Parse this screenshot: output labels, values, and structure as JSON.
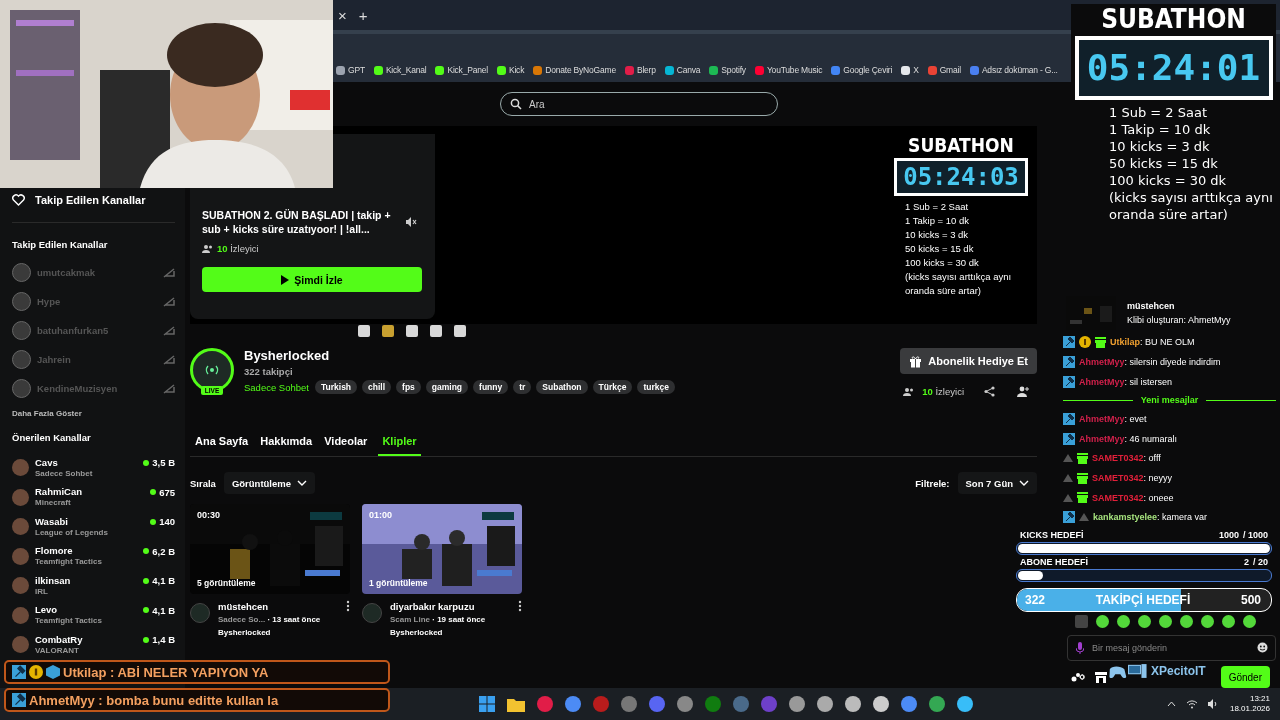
{
  "browser": {
    "tab_close": "×",
    "new_tab": "+",
    "bookmarks": [
      {
        "label": "GPT",
        "color": "#9ca3af"
      },
      {
        "label": "Kick_Kanal",
        "color": "#53fc18"
      },
      {
        "label": "Kick_Panel",
        "color": "#53fc18"
      },
      {
        "label": "Kick",
        "color": "#53fc18"
      },
      {
        "label": "Donate ByNoGame",
        "color": "#d97706"
      },
      {
        "label": "Blerp",
        "color": "#e11d48"
      },
      {
        "label": "Canva",
        "color": "#06b6d4"
      },
      {
        "label": "Spotify",
        "color": "#1db954"
      },
      {
        "label": "YouTube Music",
        "color": "#ff0033"
      },
      {
        "label": "Google Çeviri",
        "color": "#4285f4"
      },
      {
        "label": "X",
        "color": "#e5e7eb"
      },
      {
        "label": "Gmail",
        "color": "#ea4335"
      },
      {
        "label": "Adsız doküman - G...",
        "color": "#4a7ff0"
      }
    ]
  },
  "header": {
    "search": {
      "placeholder": "Ara"
    }
  },
  "sidebar": {
    "top_link": "Takip Edilen Kanallar",
    "followed_title": "Takip Edilen Kanallar",
    "followed": [
      {
        "name": "umutcakmak",
        "live": false
      },
      {
        "name": "Hype",
        "live": false
      },
      {
        "name": "batuhanfurkan5",
        "live": false
      },
      {
        "name": "Jahrein",
        "live": false
      },
      {
        "name": "KendineMuzisyen",
        "live": false
      }
    ],
    "show_more": "Daha Fazla Göster",
    "recommended_title": "Önerilen Kanallar",
    "recommended": [
      {
        "name": "Cavs",
        "category": "Sadece Sohbet",
        "viewers": "3,5 B",
        "live": true
      },
      {
        "name": "RahmiCan",
        "category": "Minecraft",
        "viewers": "675",
        "live": true
      },
      {
        "name": "Wasabi",
        "category": "League of Legends",
        "viewers": "140",
        "live": true
      },
      {
        "name": "Flomore",
        "category": "Teamfight Tactics",
        "viewers": "6,2 B",
        "live": true
      },
      {
        "name": "ilkinsan",
        "category": "IRL",
        "viewers": "4,1 B",
        "live": true
      },
      {
        "name": "Levo",
        "category": "Teamfight Tactics",
        "viewers": "4,1 B",
        "live": true
      },
      {
        "name": "CombatRy",
        "category": "VALORANT",
        "viewers": "1,4 B",
        "live": true
      }
    ]
  },
  "player": {
    "title": "SUBATHON 2. GÜN BAŞLADI | takip + sub + kicks süre uzatıyoor! | !all...",
    "viewers": "10",
    "viewers_label": "İzleyici",
    "watch_button": "Şimdi İzle",
    "muted": true,
    "carousel": [
      {
        "selected": false
      },
      {
        "selected": true
      },
      {
        "selected": false
      },
      {
        "selected": false
      },
      {
        "selected": false
      }
    ]
  },
  "stream_overlay": {
    "title": "SUBATHON",
    "timer": "05:24:03",
    "rules": [
      "1 Sub = 2 Saat",
      "1 Takip = 10 dk",
      "10 kicks = 3 dk",
      "50 kicks = 15 dk",
      "100 kicks = 30 dk",
      "(kicks sayısı arttıkça aynı oranda süre artar)"
    ]
  },
  "channel": {
    "name": "Bysherlocked",
    "followers": "322 takipçi",
    "live_badge": "LIVE",
    "category": "Sadece Sohbet",
    "tags": [
      "Turkish",
      "chill",
      "fps",
      "gaming",
      "funny",
      "tr",
      "Subathon",
      "Türkçe",
      "turkçe"
    ],
    "gift_button": "Abonelik Hediye Et",
    "viewers": "10",
    "viewers_label": "İzleyici"
  },
  "tabs": [
    {
      "label": "Ana Sayfa",
      "selected": false
    },
    {
      "label": "Hakkımda",
      "selected": false
    },
    {
      "label": "Videolar",
      "selected": false
    },
    {
      "label": "Klipler",
      "selected": true
    }
  ],
  "clips": {
    "sort_label": "Sırala",
    "sort_value": "Görüntüleme",
    "filter_label": "Filtrele:",
    "filter_value": "Son 7 Gün",
    "items": [
      {
        "duration": "00:30",
        "views": "5 görüntüleme",
        "title": "müstehcen",
        "category": "Sadece So...",
        "age": "· 13 saat önce",
        "channel": "Bysherlocked"
      },
      {
        "duration": "01:00",
        "views": "1 görüntüleme",
        "title": "diyarbakır karpuzu",
        "category": "Scam Line",
        "age": "· 19 saat önce",
        "channel": "Bysherlocked"
      }
    ]
  },
  "subathon": {
    "title": "SUBATHON",
    "timer": "05:24:01",
    "rules": [
      "1 Sub = 2 Saat",
      "1 Takip = 10 dk",
      "10 kicks = 3 dk",
      "50 kicks = 15 dk",
      "100 kicks = 30 dk",
      "(kicks sayısı arttıkça aynı oranda süre artar)"
    ]
  },
  "chat": {
    "items": [
      {
        "kind": "clip",
        "title": "müstehcen",
        "by": "Klibi oluşturan: AhmetMyy"
      },
      {
        "kind": "message",
        "user": "Utkilap",
        "color": "#f0a030",
        "text": ": BU NE OLM",
        "badges": [
          {
            "kind": "mod"
          },
          {
            "kind": "sub"
          },
          {
            "kind": "gift"
          }
        ]
      },
      {
        "kind": "message",
        "user": "AhmetMyy",
        "color": "#d0204a",
        "text": ": silersin diyede indirdim",
        "badges": [
          {
            "kind": "mod"
          }
        ]
      },
      {
        "kind": "message",
        "user": "AhmetMyy",
        "color": "#d0204a",
        "text": ": sil istersen",
        "badges": [
          {
            "kind": "mod"
          }
        ]
      },
      {
        "kind": "divider",
        "text": "Yeni mesajlar"
      },
      {
        "kind": "message",
        "user": "AhmetMyy",
        "color": "#d0204a",
        "text": ": evet",
        "badges": [
          {
            "kind": "mod"
          }
        ]
      },
      {
        "kind": "message",
        "user": "AhmetMyy",
        "color": "#d0204a",
        "text": ": 46 numaralı",
        "badges": [
          {
            "kind": "mod"
          }
        ]
      },
      {
        "kind": "message",
        "user": "SAMET0342",
        "color": "#e0203a",
        "text": ": offf",
        "badges": [
          {
            "kind": "vip"
          },
          {
            "kind": "gift"
          }
        ]
      },
      {
        "kind": "message",
        "user": "SAMET0342",
        "color": "#e0203a",
        "text": ": neyyy",
        "badges": [
          {
            "kind": "vip"
          },
          {
            "kind": "gift"
          }
        ]
      },
      {
        "kind": "message",
        "user": "SAMET0342",
        "color": "#e0203a",
        "text": ": oneee",
        "badges": [
          {
            "kind": "vip"
          },
          {
            "kind": "gift"
          }
        ]
      },
      {
        "kind": "message",
        "user": "kankamstyelee",
        "color": "#a6e37e",
        "text": ": kamera var",
        "badges": [
          {
            "kind": "mod"
          },
          {
            "kind": "vip"
          }
        ]
      }
    ],
    "goals": [
      {
        "label": "KICKS HEDEFİ",
        "current": "1000",
        "target": "/ 1000",
        "level": 1
      },
      {
        "label": "ABONE HEDEFİ",
        "current": "2",
        "target": "/ 20",
        "level": 0.1
      }
    ],
    "follower_goal": {
      "current": "322",
      "label": "TAKİPÇİ HEDEFİ",
      "target": "500",
      "level": 0.644
    },
    "placeholder": "Bir mesaj gönderin",
    "send": "Gönder"
  },
  "overlay_chat": [
    {
      "text": "Utkilap : ABİ NELER YAPIYON YA",
      "badges": [
        {
          "kind": "mod"
        },
        {
          "kind": "sub"
        },
        {
          "kind": "gift"
        }
      ]
    },
    {
      "text": "AhmetMyy : bomba bunu editte kullan la",
      "badges": [
        {
          "kind": "mod"
        }
      ]
    }
  ],
  "logo": "XPecitoIT",
  "taskbar": {
    "time": "13:21",
    "date": "18.01.2026"
  }
}
